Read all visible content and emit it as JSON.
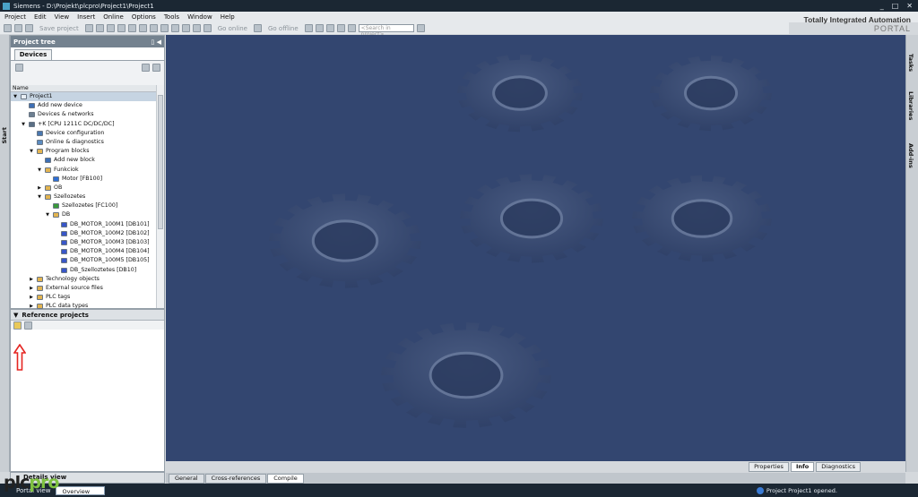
{
  "window": {
    "title": "Siemens  -  D:\\Projekt\\plcpro\\Project1\\Project1",
    "controls": [
      "_",
      "□",
      "✕"
    ]
  },
  "menu": [
    "Project",
    "Edit",
    "View",
    "Insert",
    "Online",
    "Options",
    "Tools",
    "Window",
    "Help"
  ],
  "brand": {
    "line1": "Totally Integrated Automation",
    "line2": "PORTAL"
  },
  "toolbar": {
    "save_label": "Save project",
    "go_online": "Go online",
    "go_offline": "Go offline",
    "search_placeholder": "<Search in project>"
  },
  "start_label": "Start",
  "project_tree": {
    "title": "Project tree",
    "devices_tab": "Devices",
    "name_column": "Name",
    "rows": [
      {
        "label": "Project1",
        "level": 0,
        "expander": "▼",
        "icon": "project-icon",
        "color": "#e8eef4",
        "selected": true
      },
      {
        "label": "Add new device",
        "level": 1,
        "expander": "",
        "icon": "add-device-icon",
        "color": "#3d6fb5"
      },
      {
        "label": "Devices & networks",
        "level": 1,
        "expander": "",
        "icon": "network-icon",
        "color": "#6d7f91"
      },
      {
        "label": "+K [CPU 1211C DC/DC/DC]",
        "level": 1,
        "expander": "▼",
        "icon": "cpu-icon",
        "color": "#5a6f84"
      },
      {
        "label": "Device configuration",
        "level": 2,
        "expander": "",
        "icon": "device-config-icon",
        "color": "#4a78b0"
      },
      {
        "label": "Online & diagnostics",
        "level": 2,
        "expander": "",
        "icon": "diagnostics-icon",
        "color": "#5b8bc0"
      },
      {
        "label": "Program blocks",
        "level": 2,
        "expander": "▼",
        "icon": "folder-icon",
        "color": "#e2b451"
      },
      {
        "label": "Add new block",
        "level": 3,
        "expander": "",
        "icon": "add-block-icon",
        "color": "#3d6fb5"
      },
      {
        "label": "Funkciok",
        "level": 3,
        "expander": "▼",
        "icon": "folder-icon",
        "color": "#e2b451"
      },
      {
        "label": "Motor [FB100]",
        "level": 4,
        "expander": "",
        "icon": "fb-icon",
        "color": "#2f6fd6"
      },
      {
        "label": "OB",
        "level": 3,
        "expander": "▶",
        "icon": "folder-icon",
        "color": "#e2b451"
      },
      {
        "label": "Szellozetes",
        "level": 3,
        "expander": "▼",
        "icon": "folder-icon",
        "color": "#e2b451"
      },
      {
        "label": "Szellozetes [FC100]",
        "level": 4,
        "expander": "",
        "icon": "fc-icon",
        "color": "#3a9a3a"
      },
      {
        "label": "DB",
        "level": 4,
        "expander": "▼",
        "icon": "folder-icon",
        "color": "#e2b451"
      },
      {
        "label": "DB_MOTOR_100M1 [DB101]",
        "level": 5,
        "expander": "",
        "icon": "db-icon",
        "color": "#3856c8"
      },
      {
        "label": "DB_MOTOR_100M2 [DB102]",
        "level": 5,
        "expander": "",
        "icon": "db-icon",
        "color": "#3856c8"
      },
      {
        "label": "DB_MOTOR_100M3 [DB103]",
        "level": 5,
        "expander": "",
        "icon": "db-icon",
        "color": "#3856c8"
      },
      {
        "label": "DB_MOTOR_100M4 [DB104]",
        "level": 5,
        "expander": "",
        "icon": "db-icon",
        "color": "#3856c8"
      },
      {
        "label": "DB_MOTOR_100M5 [DB105]",
        "level": 5,
        "expander": "",
        "icon": "db-icon",
        "color": "#3856c8"
      },
      {
        "label": "DB_Szelloztetes [DB10]",
        "level": 5,
        "expander": "",
        "icon": "db-icon",
        "color": "#3856c8"
      },
      {
        "label": "Technology objects",
        "level": 2,
        "expander": "▶",
        "icon": "folder-icon",
        "color": "#e2b451"
      },
      {
        "label": "External source files",
        "level": 2,
        "expander": "▶",
        "icon": "folder-icon",
        "color": "#e2b451"
      },
      {
        "label": "PLC tags",
        "level": 2,
        "expander": "▶",
        "icon": "folder-icon",
        "color": "#e2b451"
      },
      {
        "label": "PLC data types",
        "level": 2,
        "expander": "▶",
        "icon": "folder-icon",
        "color": "#e2b451"
      }
    ]
  },
  "reference_projects": {
    "title": "Reference projects",
    "toggle": "▼"
  },
  "details_view": {
    "label": "Details view"
  },
  "right_tabs": [
    "Tasks",
    "Libraries",
    "Add-ins"
  ],
  "inspector_tabs": [
    {
      "label": "Properties",
      "active": false
    },
    {
      "label": "Info",
      "active": true
    },
    {
      "label": "Diagnostics",
      "active": false
    }
  ],
  "bottom_tabs": [
    {
      "label": "General",
      "active": false
    },
    {
      "label": "Cross-references",
      "active": false
    },
    {
      "label": "Compile",
      "active": true
    }
  ],
  "status": {
    "portal_view": "Portal view",
    "overview": "Overview",
    "message": "Project Project1 opened."
  },
  "watermark": {
    "part1": "plc",
    "part2": "pro"
  },
  "colors": {
    "canvas": "#334670",
    "titlebar": "#1b2733",
    "accent_red": "#e52521",
    "panel_header": "#74828f"
  }
}
